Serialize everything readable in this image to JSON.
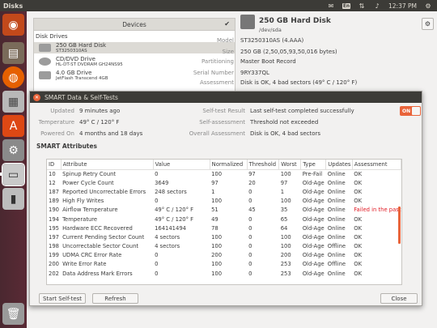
{
  "topbar": {
    "title": "Disks",
    "keyboard": "En",
    "clock": "12:37 PM"
  },
  "devices": {
    "header": "Devices",
    "section": "Disk Drives",
    "items": [
      {
        "name": "250 GB Hard Disk",
        "sub": "ST3250310AS"
      },
      {
        "name": "CD/DVD Drive",
        "sub": "HL-DT-ST DVDRAM GH24NS95"
      },
      {
        "name": "4.0 GB Drive",
        "sub": "JetFlash Transcend 4GB"
      }
    ]
  },
  "disk": {
    "title": "250 GB Hard Disk",
    "path": "/dev/sda",
    "rows": [
      {
        "k": "Model",
        "v": "ST3250310AS (4.AAA)"
      },
      {
        "k": "Size",
        "v": "250 GB (2,50,05,93,50,016 bytes)"
      },
      {
        "k": "Partitioning",
        "v": "Master Boot Record"
      },
      {
        "k": "Serial Number",
        "v": "9RY337QL"
      },
      {
        "k": "Assessment",
        "v": "Disk is OK, 4 bad sectors (49° C / 120° F)"
      }
    ]
  },
  "dialog": {
    "title": "SMART Data & Self-Tests",
    "left": [
      {
        "k": "Updated",
        "v": "9 minutes ago"
      },
      {
        "k": "Temperature",
        "v": "49° C / 120° F"
      },
      {
        "k": "Powered On",
        "v": "4 months and 18 days"
      }
    ],
    "right": [
      {
        "k": "Self-test Result",
        "v": "Last self-test completed successfully"
      },
      {
        "k": "Self-assessment",
        "v": "Threshold not exceeded"
      },
      {
        "k": "Overall Assessment",
        "v": "Disk is OK, 4 bad sectors"
      }
    ],
    "toggle": "ON",
    "section": "SMART Attributes",
    "columns": [
      "ID",
      "Attribute",
      "Value",
      "Normalized",
      "Threshold",
      "Worst",
      "Type",
      "Updates",
      "Assessment"
    ],
    "rows": [
      [
        "10",
        "Spinup Retry Count",
        "0",
        "100",
        "97",
        "100",
        "Pre-Fail",
        "Online",
        "OK"
      ],
      [
        "12",
        "Power Cycle Count",
        "3649",
        "97",
        "20",
        "97",
        "Old-Age",
        "Online",
        "OK"
      ],
      [
        "187",
        "Reported Uncorrectable Errors",
        "248 sectors",
        "1",
        "0",
        "1",
        "Old-Age",
        "Online",
        "OK"
      ],
      [
        "189",
        "High Fly Writes",
        "0",
        "100",
        "0",
        "100",
        "Old-Age",
        "Online",
        "OK"
      ],
      [
        "190",
        "Airflow Temperature",
        "49° C / 120° F",
        "51",
        "45",
        "35",
        "Old-Age",
        "Online",
        "Failed in the past"
      ],
      [
        "194",
        "Temperature",
        "49° C / 120° F",
        "49",
        "0",
        "65",
        "Old-Age",
        "Online",
        "OK"
      ],
      [
        "195",
        "Hardware ECC Recovered",
        "164141494",
        "78",
        "0",
        "64",
        "Old-Age",
        "Online",
        "OK"
      ],
      [
        "197",
        "Current Pending Sector Count",
        "4 sectors",
        "100",
        "0",
        "100",
        "Old-Age",
        "Online",
        "OK"
      ],
      [
        "198",
        "Uncorrectable Sector Count",
        "4 sectors",
        "100",
        "0",
        "100",
        "Old-Age",
        "Offline",
        "OK"
      ],
      [
        "199",
        "UDMA CRC Error Rate",
        "0",
        "200",
        "0",
        "200",
        "Old-Age",
        "Online",
        "OK"
      ],
      [
        "200",
        "Write Error Rate",
        "0",
        "100",
        "0",
        "253",
        "Old-Age",
        "Offline",
        "OK"
      ],
      [
        "202",
        "Data Address Mark Errors",
        "0",
        "100",
        "0",
        "253",
        "Old-Age",
        "Online",
        "OK"
      ]
    ],
    "buttons": {
      "selftest": "Start Self-test",
      "refresh": "Refresh",
      "close": "Close"
    }
  }
}
